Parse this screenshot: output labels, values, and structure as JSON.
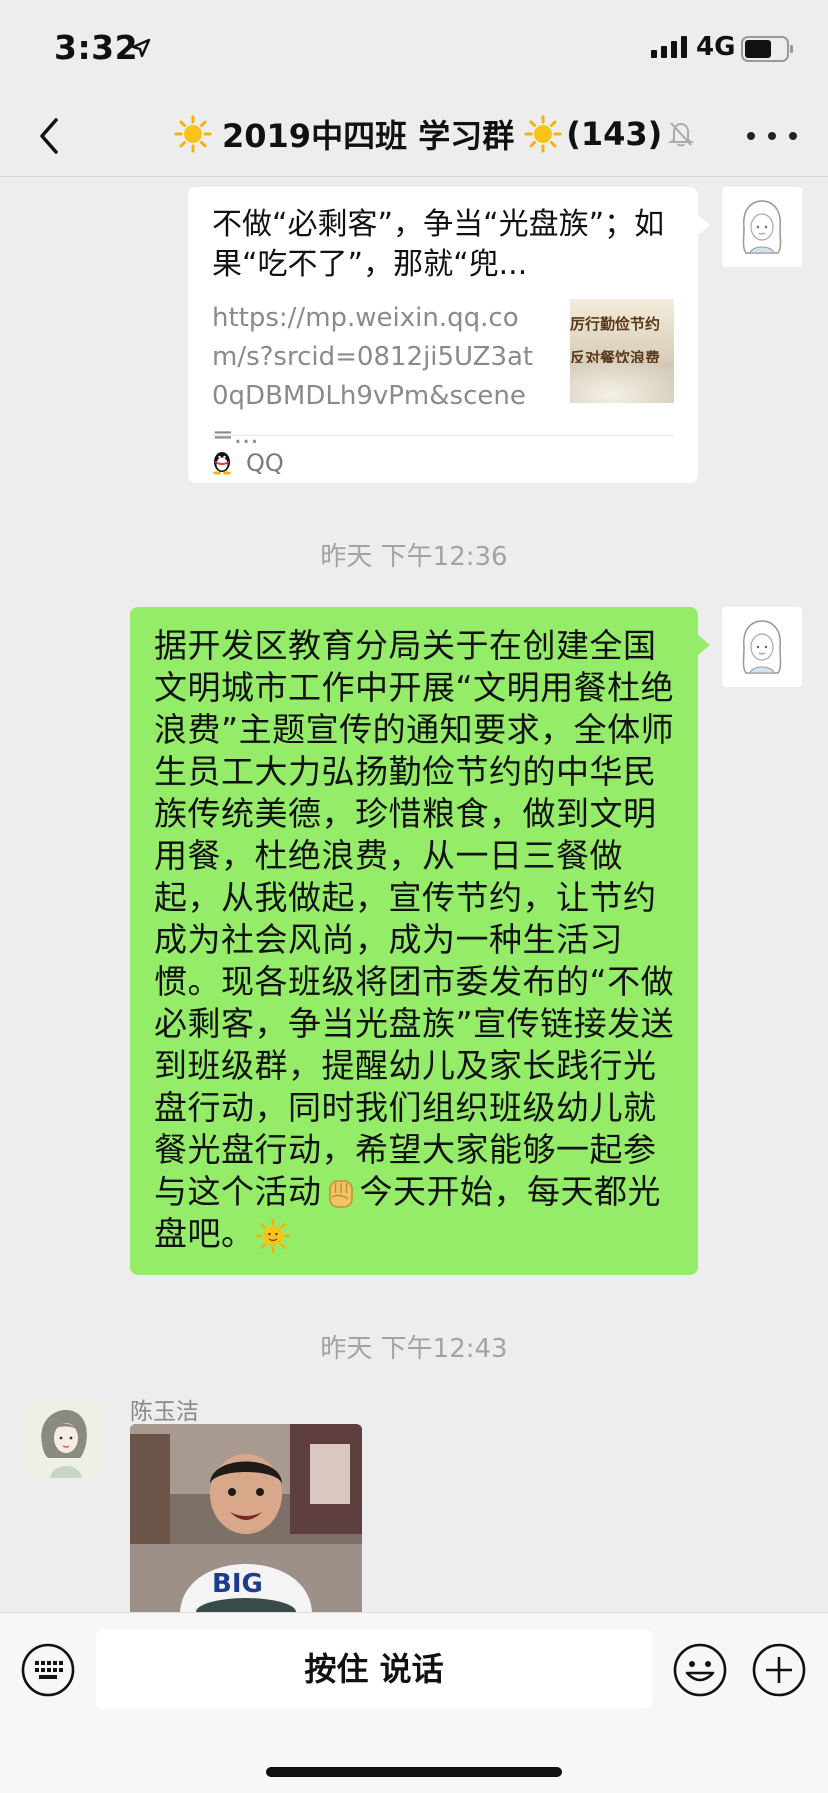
{
  "status_bar": {
    "time": "3:32",
    "network": "4G"
  },
  "nav": {
    "title": "2019中四班 学习群",
    "member_count": "(143)"
  },
  "link_card": {
    "title": "不做“必剩客”，争当“光盘族”；如果“吃不了”，那就“兜...",
    "url": "https://mp.weixin.qq.com/s?srcid=0812ji5UZ3at0qDBMDLh9vPm&scene=...",
    "thumb_line1": "厉行勤俭节约",
    "thumb_line2": "反对餐饮浪费",
    "source": "QQ"
  },
  "time_1": "昨天 下午12:36",
  "message": {
    "text": "据开发区教育分局关于在创建全国文明城市工作中开展“文明用餐杜绝浪费”主题宣传的通知要求，全体师生员工大力弘扬勤俭节约的中华民族传统美德，珍惜粮食，做到文明用餐，杜绝浪费，从一日三餐做起，从我做起，宣传节约，让节约成为社会风尚，成为一种生活习惯。现各班级将团市委发布的“不做必剩客，争当光盘族”宣传链接发送到班级群，提醒幼儿及家长践行光盘行动，同时我们组织班级幼儿就餐光盘行动，希望大家能够一起参与这个活动",
    "text_after": "今天开始，每天都光盘吧。"
  },
  "time_2": "昨天 下午12:43",
  "incoming": {
    "sender": "陈玉洁",
    "photo_text": "BIG"
  },
  "input_bar": {
    "talk_label": "按住 说话"
  },
  "colors": {
    "bubble_green": "#95ec69",
    "background": "#ededed"
  },
  "icons": [
    "location-arrow-icon",
    "signal-icon",
    "battery-icon",
    "back-chevron-icon",
    "sun-emoji-icon",
    "mute-bell-icon",
    "more-dots-icon",
    "qq-penguin-icon",
    "fist-emoji-icon",
    "keyboard-icon",
    "emoji-face-icon",
    "plus-icon"
  ]
}
